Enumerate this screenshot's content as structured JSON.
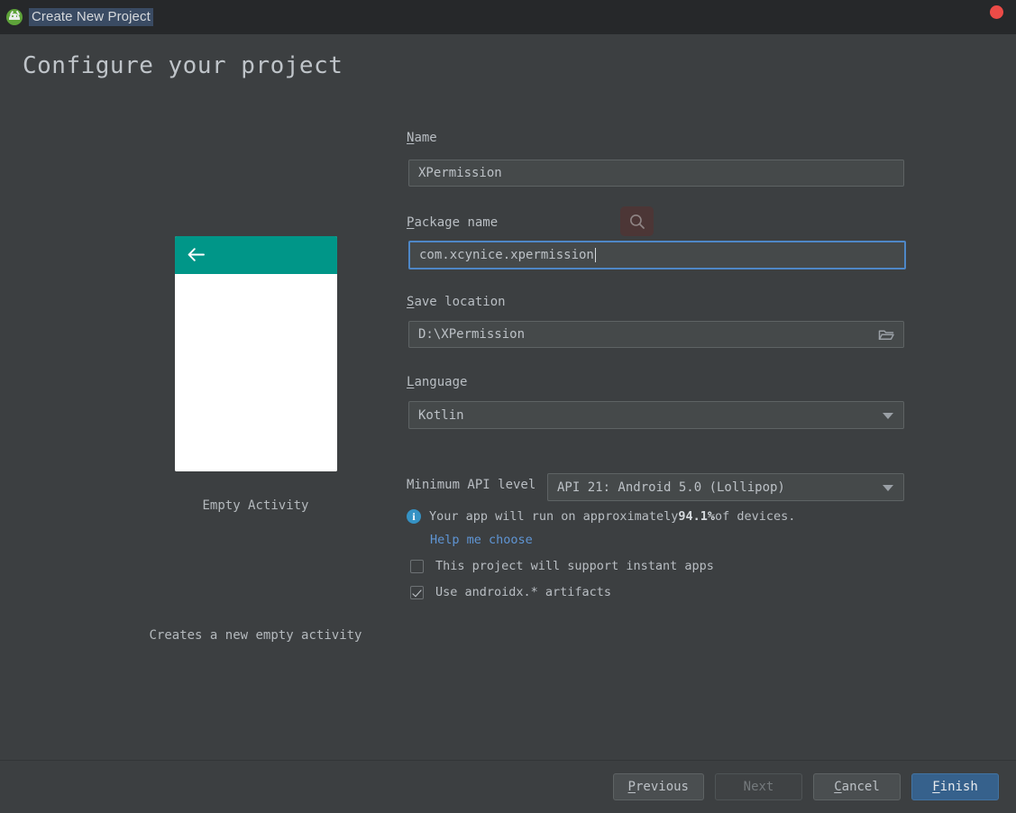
{
  "window": {
    "title": "Create New Project",
    "logo_icon": "android-studio-logo",
    "close_icon": "close-dot-icon"
  },
  "page": {
    "heading": "Configure your project"
  },
  "preview": {
    "back_icon": "back-arrow-icon",
    "appbar_color": "#009688",
    "caption": "Empty Activity",
    "description": "Creates a new empty activity"
  },
  "form": {
    "name": {
      "label_mnemonic": "N",
      "label_rest": "ame",
      "value": "XPermission"
    },
    "package": {
      "label_mnemonic": "P",
      "label_rest": "ackage name",
      "value": "com.xcynice.xpermission",
      "search_icon": "search-icon",
      "focused": true
    },
    "save_location": {
      "label_mnemonic": "S",
      "label_rest": "ave location",
      "value": "D:\\XPermission",
      "browse_icon": "folder-icon"
    },
    "language": {
      "label_mnemonic": "L",
      "label_rest": "anguage",
      "value": "Kotlin",
      "dropdown_icon": "chevron-down-icon"
    },
    "min_api": {
      "label": "Minimum API level",
      "value": "API 21: Android 5.0 (Lollipop)",
      "dropdown_icon": "chevron-down-icon"
    },
    "devices_note": {
      "info_icon": "info-icon",
      "icon_glyph": "i",
      "prefix": "Your app will run on approximately ",
      "percent": "94.1%",
      "suffix": " of devices.",
      "help_link": "Help me choose",
      "link_color": "#5f95d4"
    },
    "instant_apps": {
      "label": "This project will support instant apps",
      "checked": false
    },
    "androidx": {
      "label": "Use androidx.* artifacts",
      "checked": true
    }
  },
  "buttons": {
    "previous": {
      "mnemonic": "P",
      "rest": "revious",
      "enabled": true
    },
    "next": {
      "mnemonic": "",
      "rest": "Next",
      "enabled": false
    },
    "cancel": {
      "mnemonic": "C",
      "rest": "ancel",
      "enabled": true
    },
    "finish": {
      "mnemonic": "F",
      "rest": "inish",
      "enabled": true,
      "primary_color": "#36618c"
    }
  }
}
